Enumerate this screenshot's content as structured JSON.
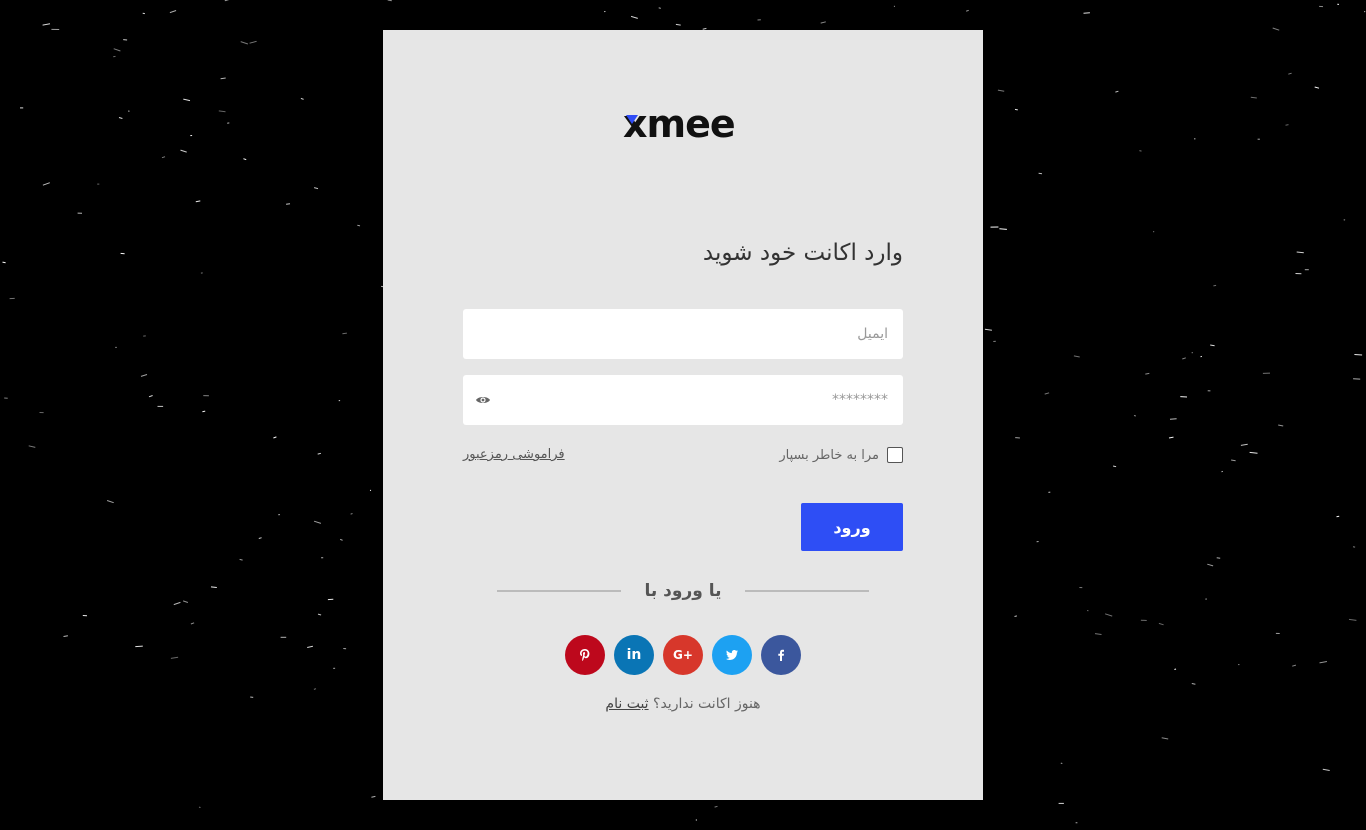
{
  "brand": {
    "logo_text": "xmee",
    "accent_color": "#2f4cf5"
  },
  "login": {
    "title": "وارد اکانت خود شوید",
    "email_placeholder": "ایمیل",
    "password_placeholder": "********",
    "remember_label": "مرا به خاطر بسپار",
    "remember_checked": false,
    "forgot_label": "فراموشی رمزعبور",
    "submit_label": "ورود",
    "submit_color": "#2e4ef5"
  },
  "divider": {
    "label": "یا ورود با"
  },
  "social": [
    {
      "name": "pinterest-icon",
      "color": "#bd081c"
    },
    {
      "name": "linkedin-icon",
      "color": "#0a75b5",
      "text": "in"
    },
    {
      "name": "google-plus-icon",
      "color": "#d7372b",
      "text": "G+"
    },
    {
      "name": "twitter-icon",
      "color": "#1da1f2"
    },
    {
      "name": "facebook-icon",
      "color": "#3b579d"
    }
  ],
  "signup": {
    "prompt": "هنوز اکانت ندارید؟",
    "link_label": "ثبت نام"
  }
}
